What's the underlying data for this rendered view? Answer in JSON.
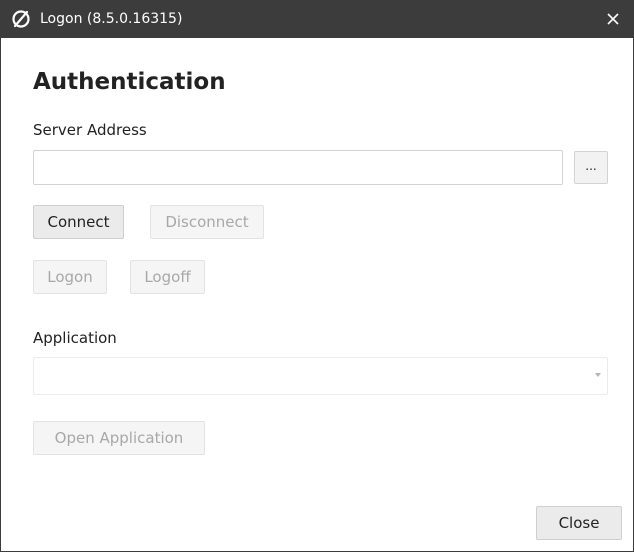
{
  "window": {
    "title": "Logon (8.5.0.16315)",
    "close_glyph": "✕",
    "icon": "slashed-circle-icon"
  },
  "form": {
    "heading": "Authentication",
    "server_address_label": "Server Address",
    "server_address_value": "",
    "browse_label": "...",
    "connect_label": "Connect",
    "disconnect_label": "Disconnect",
    "logon_label": "Logon",
    "logoff_label": "Logoff",
    "application_label": "Application",
    "application_selected": "",
    "open_application_label": "Open Application",
    "close_label": "Close"
  },
  "states": {
    "connect_enabled": true,
    "disconnect_enabled": false,
    "logon_enabled": false,
    "logoff_enabled": false,
    "application_enabled": false,
    "open_application_enabled": false,
    "close_enabled": true
  },
  "colors": {
    "titlebar": "#3c3c3c",
    "title_text": "#ffffff",
    "enabled_button_bg": "#ebebeb",
    "disabled_text": "#a8a8a8"
  }
}
